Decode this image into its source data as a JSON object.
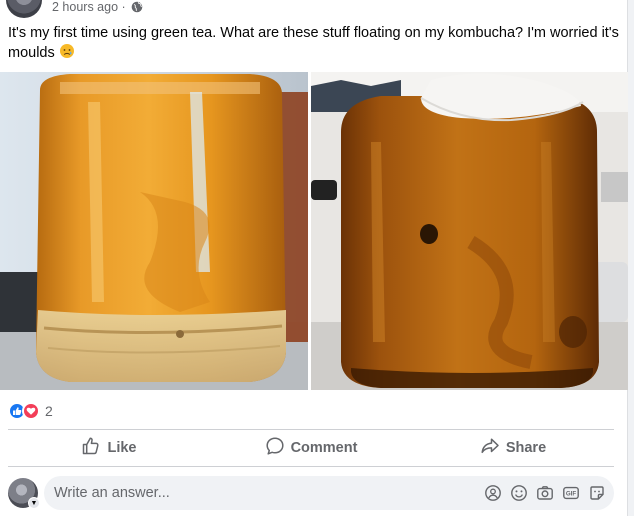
{
  "post": {
    "timestamp": "2 hours ago ·",
    "text": "It's my first time using green tea. What are these stuff floating on my kombucha? I'm worried it's moulds"
  },
  "reactions": {
    "count": "2"
  },
  "actions": {
    "like": "Like",
    "comment": "Comment",
    "share": "Share"
  },
  "comment_box": {
    "placeholder": "Write an answer..."
  },
  "icons": [
    "globe-icon",
    "sad-emoji-icon",
    "like-reaction-icon",
    "love-reaction-icon",
    "like-icon",
    "comment-icon",
    "share-icon",
    "avatar-icon",
    "avatar-icon",
    "chevron-down-icon",
    "avatar-sticker-icon",
    "emoji-icon",
    "camera-icon",
    "gif-icon",
    "sticker-icon"
  ],
  "colors": {
    "accent": "#1877f2",
    "love": "#f33e58",
    "muted": "#65676b"
  }
}
